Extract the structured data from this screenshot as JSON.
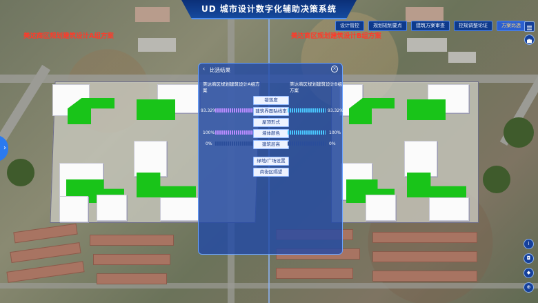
{
  "app": {
    "title": "UD 城市设计数字化辅助决策系统"
  },
  "tabs": [
    {
      "label": "设计管控"
    },
    {
      "label": "规划规划要点"
    },
    {
      "label": "建筑方案审查"
    },
    {
      "label": "控规调整论证"
    },
    {
      "label": "方案比选"
    }
  ],
  "scheme_labels": {
    "left": "美达商区规划建筑设计A组方案",
    "right": "美达商区规划建筑设计B组方案"
  },
  "compare": {
    "header": "比选结果",
    "scheme_a": "美达商区规划建筑设计A组方案",
    "scheme_b": "美达商区规划建筑设计B组方案",
    "metrics": [
      {
        "label": "错落度"
      },
      {
        "label": "建筑界面贴线率",
        "a_pct": "93.32%",
        "b_pct": "93.32%",
        "a_value": 0.93,
        "b_value": 0.93
      },
      {
        "label": "屋顶形式"
      },
      {
        "label": "墙体颜色",
        "a_pct": "100%",
        "b_pct": "100%",
        "a_value": 1.0,
        "b_value": 1.0
      },
      {
        "label": "建筑层高",
        "a_pct": "0%",
        "b_pct": "0%",
        "a_value": 0.0,
        "b_value": 0.0
      },
      {
        "label": "绿地/广场设置"
      },
      {
        "label": "商街区隔望"
      }
    ]
  },
  "icons": {
    "left_toggle": "chevron-right-icon",
    "menu": "list-icon",
    "sidebar_top": "camera-icon",
    "right_tools": [
      "info-icon",
      "camera-icon",
      "layers-icon",
      "compass-icon"
    ]
  }
}
